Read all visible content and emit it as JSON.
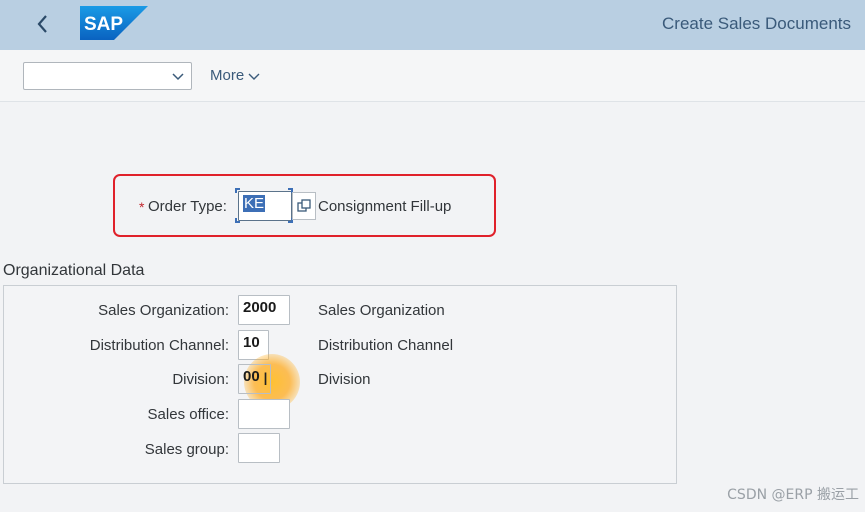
{
  "shell": {
    "logo_text": "SAP",
    "title": "Create Sales Documents",
    "brand_color": "#0a6ed1",
    "bar_color": "#b9cfe2"
  },
  "toolbar": {
    "variant_value": "",
    "more_label": "More"
  },
  "order": {
    "label": "Order Type:",
    "required_mark": "*",
    "value": "KE",
    "description": "Consignment Fill-up"
  },
  "org": {
    "section_title": "Organizational Data",
    "rows": [
      {
        "label": "Sales Organization:",
        "value": "2000",
        "description": "Sales Organization"
      },
      {
        "label": "Distribution Channel:",
        "value": "10",
        "description": "Distribution Channel"
      },
      {
        "label": "Division:",
        "value": "00",
        "description": "Division"
      },
      {
        "label": "Sales office:",
        "value": "",
        "description": ""
      },
      {
        "label": "Sales group:",
        "value": "",
        "description": ""
      }
    ]
  },
  "watermark": "CSDN @ERP 搬运工",
  "icons": {
    "back": "chevron-left-icon",
    "dropdown": "chevron-down-icon",
    "value_help": "value-help-icon"
  }
}
